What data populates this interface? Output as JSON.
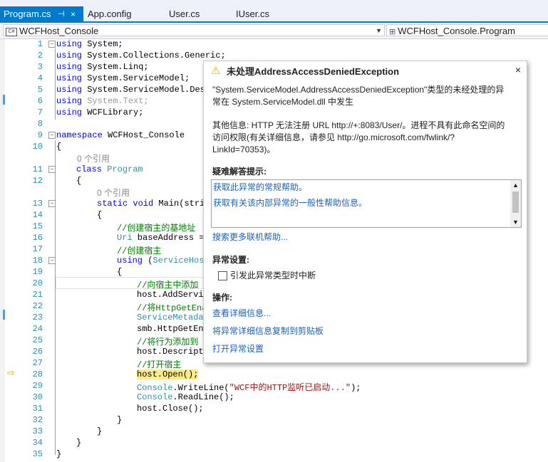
{
  "tabs": [
    {
      "label": "Program.cs",
      "pin": "⊣",
      "close": "×"
    },
    {
      "label": "App.config"
    },
    {
      "label": "User.cs"
    },
    {
      "label": "IUser.cs"
    }
  ],
  "nav": {
    "project": "WCFHost_Console",
    "class": "WCFHost_Console.Program",
    "project_icon": "C#"
  },
  "line_numbers": [
    "1",
    "2",
    "3",
    "4",
    "5",
    "6",
    "7",
    "8",
    "9",
    "10",
    "11",
    "12",
    "13",
    "14",
    "15",
    "16",
    "17",
    "18",
    "19",
    "20",
    "21",
    "22",
    "23",
    "24",
    "25",
    "26",
    "27",
    "28",
    "29",
    "30",
    "31",
    "32",
    "33",
    "34",
    "35"
  ],
  "code": {
    "l1": [
      "using",
      " System;"
    ],
    "l2": [
      "using",
      " System.Collections.Generic;"
    ],
    "l3": [
      "using",
      " System.Linq;"
    ],
    "l4": [
      "using",
      " System.ServiceModel;"
    ],
    "l5": [
      "using",
      " System.ServiceModel.Desc"
    ],
    "l6": [
      "using",
      " System.Text;"
    ],
    "l7": [
      "using",
      " WCFLibrary;"
    ],
    "l9": [
      "namespace",
      " WCFHost_Console"
    ],
    "l10": "{",
    "ref_class": "0 个引用",
    "l11": [
      "class",
      " ",
      "Program"
    ],
    "l12": "{",
    "ref_main": "0 个引用",
    "l13": [
      "static",
      " ",
      "void",
      " Main(strin"
    ],
    "l14": "{",
    "l15": "//创建宿主的基地址",
    "l16": [
      "Uri",
      " baseAddress ="
    ],
    "l17": "//创建宿主",
    "l18": [
      "using",
      " (",
      "ServiceHost"
    ],
    "l19": "{",
    "l20": "//向宿主中添加",
    "l21": "host.AddServic",
    "l22": "//将HttpGetEna",
    "l23": "ServiceMetadat",
    "l24": "smb.HttpGetEna",
    "l25": "//将行为添加到",
    "l26": "host.Descripti",
    "l27": "//打开宿主",
    "l28": "host.Open();",
    "l29": [
      "Console",
      ".WriteLine(",
      "\"WCF中的HTTP监听已启动...\"",
      ");"
    ],
    "l30": [
      "Console",
      ".ReadLine();"
    ],
    "l31": "host.Close();",
    "l32": "}",
    "l33": "}",
    "l34": "}",
    "l35": "}"
  },
  "exception": {
    "title": "未处理AddressAccessDeniedException",
    "close": "×",
    "message_line1": "\"System.ServiceModel.AddressAccessDeniedException\"类型的未经处理的异",
    "message_line2": "常在 System.ServiceModel.dll 中发生",
    "info_line1": "其他信息: HTTP 无法注册 URL http://+:8083/User/。进程不具有此命名空间的",
    "info_line2": "访问权限(有关详细信息，请参见 http://go.microsoft.com/fwlink/?",
    "info_line3": "LinkId=70353)。",
    "troubleshooting_heading": "疑难解答提示:",
    "tips": [
      "获取此异常的常规帮助。",
      "获取有关该内部异常的一般性帮助信息。"
    ],
    "search_online": "搜索更多联机帮助...",
    "settings_heading": "异常设置:",
    "break_checkbox_label": "引发此异常类型时中断",
    "actions_heading": "操作:",
    "actions": [
      "查看详细信息...",
      "将异常详细信息复制到剪贴板",
      "打开异常设置"
    ]
  }
}
